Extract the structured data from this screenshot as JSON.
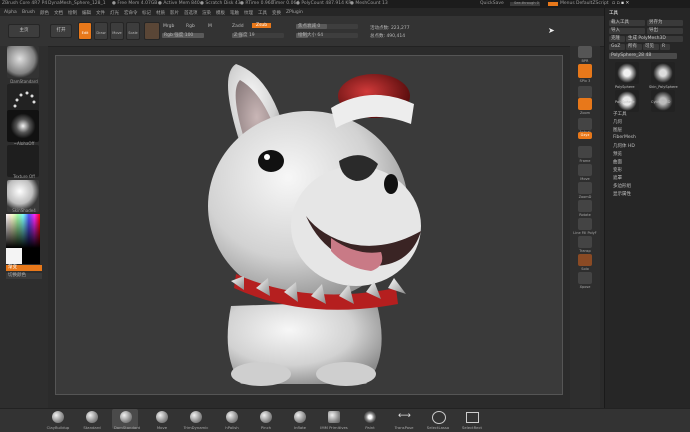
{
  "titlebar": {
    "app": "ZBrush Core 4R7 P4",
    "document": "DynaMesh_Sphere_128_1",
    "stats": [
      "● Free Mem 4.07GB",
      "● Active Mem 840",
      "● Scratch Disk 43",
      "● RTime 0.960",
      "Timer 0.064",
      "● PolyCount 487.914 KP",
      "● MeshCount 13"
    ],
    "quicksave": "QuickSave",
    "see_through": "See-through 0",
    "menus_label": "Menus",
    "script": "DefaultZScript"
  },
  "menubar": [
    "Alpha",
    "Brush",
    "颜色",
    "文档",
    "绘制",
    "编辑",
    "文件",
    "灯光",
    "宏命令",
    "标记",
    "材质",
    "影片",
    "首选项",
    "渲染",
    "模板",
    "笔触",
    "纹理",
    "工具",
    "变换",
    "ZPlugin"
  ],
  "topshelf": {
    "tool_buttons": [
      "Home",
      "Edit",
      "Draw",
      "Move",
      "Scale",
      "Rotate"
    ],
    "mrgb": "Mrgb",
    "rgb": "Rgb",
    "m": "M",
    "zadd": "Zadd",
    "zsub": "Zsub",
    "focal_shift": "焦点衰减 0",
    "draw_size": "绘制大小 64",
    "z_intensity": "Z 强度 19",
    "rgb_intensity": "Rgb 强度 100",
    "active_points": "活动点数: 223,277",
    "total_points": "总点数: 490,414"
  },
  "left_panel": {
    "brush": "DamStandard",
    "stroke": "Dots",
    "alpha": "~AlphaOff",
    "texture": "Texture Off",
    "material": "SkinShade4",
    "gradient": "渐变",
    "switch_color": "切换颜色"
  },
  "right_shelf": [
    "BPR",
    "SPix 3",
    "Scroll",
    "Zoom",
    "Actual",
    "AAHalf",
    "Persp",
    "Floor",
    "Local",
    "Gxyz",
    "Frame",
    "Move",
    "ZoomD",
    "Rotate",
    "Line Fill PolyF",
    "Transp",
    "Ghost",
    "Solo",
    "Xpose"
  ],
  "tool_panel": {
    "header": "工具",
    "load": "载入工具",
    "save_as": "另存为",
    "import": "导入",
    "export": "导出",
    "clone": "克隆",
    "make_polymesh": "生成 PolyMesh3D",
    "goz": "GoZ",
    "all": "所有",
    "visible": "可见",
    "r": "R",
    "current_tool": "PolySphere_28",
    "tool_value": "48",
    "thumbs": [
      "PolySphere",
      "Skin_PolySphere",
      "PolySphere",
      "Cylinder3D"
    ],
    "sections": [
      "子工具",
      "几何",
      "图层",
      "FiberMesh",
      "几何体 HD",
      "预览",
      "曲面",
      "变形",
      "遮罩",
      "多边形组",
      "显示属性"
    ]
  },
  "bottom_shelf": [
    "ClayBuildup",
    "Standard",
    "DamStandard",
    "Move",
    "TrimDynamic",
    "hPolish",
    "Pinch",
    "Inflate",
    "IMM Primitives",
    "Paint",
    "TransPose",
    "SelectLasso",
    "SelectRect"
  ],
  "colors": {
    "accent": "#e8781a",
    "panel": "#2e2e2e",
    "canvas": "#3a3a3a"
  },
  "icons": [
    "dog-sculpt",
    "santa-hat",
    "spiked-collar"
  ]
}
